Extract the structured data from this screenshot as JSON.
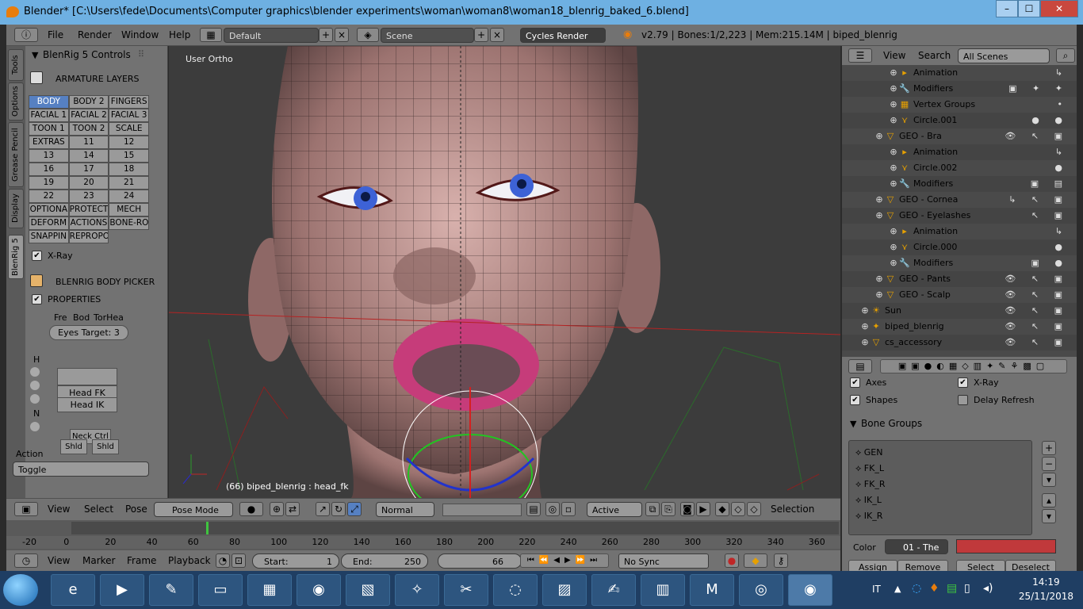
{
  "window": {
    "title": "Blender* [C:\\Users\\fede\\Documents\\Computer graphics\\blender experiments\\woman\\woman8\\woman18_blenrig_baked_6.blend]",
    "minimize": "–",
    "maximize": "☐",
    "close": "✕"
  },
  "topbar": {
    "menus": [
      "File",
      "Render",
      "Window",
      "Help"
    ],
    "layout": "Default",
    "scene": "Scene",
    "engine": "Cycles Render",
    "stats": "v2.79 | Bones:1/2,223 | Mem:215.14M | biped_blenrig"
  },
  "tool_tabs": [
    "Tools",
    "Options",
    "Grease Pencil",
    "Display",
    "BlenRig 5"
  ],
  "blenrig": {
    "panel_title": "BlenRig 5 Controls",
    "armature_layers_label": "ARMATURE LAYERS",
    "layer_buttons": [
      "BODY",
      "BODY 2",
      "FINGERS",
      "FACIAL 1",
      "FACIAL 2",
      "FACIAL 3",
      "TOON 1",
      "TOON 2",
      "SCALE",
      "EXTRAS",
      "11",
      "12",
      "13",
      "14",
      "15",
      "16",
      "17",
      "18",
      "19",
      "20",
      "21",
      "22",
      "23",
      "24",
      "OPTIONA",
      "PROTECT",
      "MECH",
      "DEFORM",
      "ACTIONS",
      "BONE-RO",
      "SNAPPIN",
      "REPROPO"
    ],
    "xray_label": "X-Ray",
    "body_picker_label": "BLENRIG BODY PICKER",
    "properties_label": "PROPERTIES",
    "picker_tabs": [
      "Fre",
      "Bod",
      "TorHea"
    ],
    "eyes_target": "Eyes Target:  3",
    "picker_letters": [
      "H",
      "N"
    ],
    "head_fk": "Head FK",
    "head_ik": "Head IK",
    "neck_ctrl": "Neck Ctrl",
    "shld_left": "Shld",
    "shld_right": "Shld",
    "action_label": "Action",
    "action_value": "Toggle"
  },
  "viewport": {
    "view_label": "User Ortho",
    "status": "(66) biped_blenrig : head_fk"
  },
  "viewport_header": {
    "menus": [
      "View",
      "Select",
      "Pose"
    ],
    "mode": "Pose Mode",
    "orientation": "Normal",
    "pivot": "Active",
    "selection_label": "Selection"
  },
  "timeline": {
    "ticks": [
      "-20",
      "0",
      "20",
      "40",
      "60",
      "80",
      "100",
      "120",
      "140",
      "160",
      "180",
      "200",
      "220",
      "240",
      "260",
      "280",
      "300",
      "320",
      "340",
      "360"
    ],
    "current_frame_value": 66,
    "menus": [
      "View",
      "Marker",
      "Frame",
      "Playback"
    ],
    "start_label": "Start:",
    "start_value": "1",
    "end_label": "End:",
    "end_value": "250",
    "current_frame": "66",
    "sync": "No Sync"
  },
  "outliner": {
    "menus": [
      "View",
      "Search"
    ],
    "filter": "All Scenes",
    "rows": [
      {
        "indent": 4,
        "icon": "▸",
        "label": "Animation",
        "right": "↳"
      },
      {
        "indent": 4,
        "icon": "🔧",
        "label": "Modifiers",
        "right": "▣ ✦ ✦"
      },
      {
        "indent": 4,
        "icon": "▦",
        "label": "Vertex Groups",
        "right": "•"
      },
      {
        "indent": 4,
        "icon": "⋎",
        "label": "Circle.001",
        "right": "● ●"
      },
      {
        "indent": 3,
        "icon": "▽",
        "label": "GEO - Bra",
        "right": "👁 ↖ ▣"
      },
      {
        "indent": 4,
        "icon": "▸",
        "label": "Animation",
        "right": "↳"
      },
      {
        "indent": 4,
        "icon": "⋎",
        "label": "Circle.002",
        "right": "●"
      },
      {
        "indent": 4,
        "icon": "🔧",
        "label": "Modifiers",
        "right": "▣ ▤"
      },
      {
        "indent": 3,
        "icon": "▽",
        "label": "GEO - Cornea",
        "right": "↳ ↖ ▣"
      },
      {
        "indent": 3,
        "icon": "▽",
        "label": "GEO - Eyelashes",
        "right": "↖ ▣"
      },
      {
        "indent": 4,
        "icon": "▸",
        "label": "Animation",
        "right": "↳"
      },
      {
        "indent": 4,
        "icon": "⋎",
        "label": "Circle.000",
        "right": "●"
      },
      {
        "indent": 4,
        "icon": "🔧",
        "label": "Modifiers",
        "right": "▣ ●"
      },
      {
        "indent": 3,
        "icon": "▽",
        "label": "GEO - Pants",
        "right": "👁 ↖ ▣"
      },
      {
        "indent": 3,
        "icon": "▽",
        "label": "GEO - Scalp",
        "right": "👁 ↖ ▣"
      },
      {
        "indent": 2,
        "icon": "☀",
        "label": "Sun",
        "right": "👁 ↖ ▣"
      },
      {
        "indent": 2,
        "icon": "✦",
        "label": "biped_blenrig",
        "right": "👁 ↖ ▣"
      },
      {
        "indent": 2,
        "icon": "▽",
        "label": "cs_accessory",
        "right": "👁 ↖ ▣"
      }
    ]
  },
  "properties": {
    "axes_label": "Axes",
    "xray_label": "X-Ray",
    "shapes_label": "Shapes",
    "delay_refresh_label": "Delay Refresh",
    "bone_groups_title": "Bone Groups",
    "bone_groups": [
      "GEN",
      "FK_L",
      "FK_R",
      "IK_L",
      "IK_R"
    ],
    "color_label": "Color",
    "color_set": "01 - The",
    "assign": "Assign",
    "remove": "Remove",
    "select": "Select",
    "deselect": "Deselect",
    "accent_color": "#5680c2",
    "color_swatch": "#c0393b"
  },
  "taskbar": {
    "language": "IT",
    "time": "14:19",
    "date": "25/11/2018",
    "apps": [
      "internet-explorer",
      "media-player",
      "paint",
      "file-explorer",
      "office",
      "firefox",
      "photos",
      "help",
      "gimp",
      "ccleaner",
      "photo-viewer",
      "notepad",
      "task-manager",
      "md",
      "chrome",
      "blender"
    ]
  }
}
